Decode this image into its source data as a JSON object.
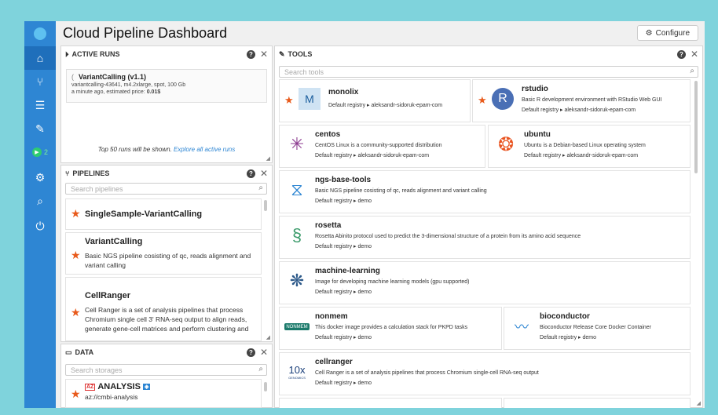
{
  "app": {
    "title": "Cloud Pipeline Dashboard",
    "configure_label": "Configure"
  },
  "nav": {
    "runs_count": "2"
  },
  "active_runs": {
    "header": "ACTIVE RUNS",
    "run": {
      "prefix": "(",
      "name": "VariantCalling (v1.1)",
      "meta": "variantcalling-43641, m4.2xlarge, spot, 100 Gb",
      "time_text": "a minute ago, estimated price: ",
      "price": "0.01$"
    },
    "footer_text": "Top 50 runs will be shown. ",
    "footer_link": "Explore all active runs"
  },
  "pipelines": {
    "header": "PIPELINES",
    "search_placeholder": "Search pipelines",
    "items": [
      {
        "name": "SingleSample-VariantCalling",
        "desc": ""
      },
      {
        "name": "VariantCalling",
        "desc": "Basic NGS pipeline cosisting of qc, reads alignment and variant calling"
      },
      {
        "name": "CellRanger",
        "desc": "Cell Ranger is a set of analysis pipelines that process Chromium single cell 3' RNA-seq output to align reads, generate gene-cell matrices and perform clustering and"
      }
    ]
  },
  "data": {
    "header": "DATA",
    "search_placeholder": "Search storages",
    "items": [
      {
        "badge": "AZ",
        "name": "ANALYSIS",
        "path": "az://cmbi-analysis"
      }
    ]
  },
  "tools": {
    "header": "TOOLS",
    "search_placeholder": "Search tools",
    "items": [
      {
        "name": "monolix",
        "desc": "",
        "registry": "Default registry ▸ aleksandr-sidoruk-epam-com"
      },
      {
        "name": "rstudio",
        "desc": "Basic R development environment with RStudio Web GUI",
        "registry": "Default registry ▸ aleksandr-sidoruk-epam-com"
      },
      {
        "name": "centos",
        "desc": "CentOS Linux is a community-supported distribution",
        "registry": "Default registry ▸ aleksandr-sidoruk-epam-com"
      },
      {
        "name": "ubuntu",
        "desc": "Ubuntu is a Debian-based Linux operating system",
        "registry": "Default registry ▸ aleksandr-sidoruk-epam-com"
      },
      {
        "name": "ngs-base-tools",
        "desc": "Basic NGS pipeline cosisting of qc, reads alignment and variant calling",
        "registry": "Default registry ▸ demo"
      },
      {
        "name": "rosetta",
        "desc": "Rosetta Abinito protocol used to predict the 3-dimensional structure of a protein from its amino acid sequence",
        "registry": "Default registry ▸ demo"
      },
      {
        "name": "machine-learning",
        "desc": "Image for developing machine learning models (gpu supported)",
        "registry": "Default registry ▸ demo"
      },
      {
        "name": "nonmem",
        "desc": "This docker image provides a calculation stack for PKPD tasks",
        "registry": "Default registry ▸ demo"
      },
      {
        "name": "bioconductor",
        "desc": "Bioconductor Release Core Docker Container",
        "registry": "Default registry ▸ demo"
      },
      {
        "name": "cellranger",
        "desc": "Cell Ranger is a set of analysis pipelines that process Chromium single-cell RNA-seq output",
        "registry": "Default registry ▸ demo"
      }
    ],
    "logos": {
      "rstudio": "R",
      "nonmem": "NONMEM",
      "cellranger": "10x",
      "cellranger_sub": "GENOMICS"
    }
  },
  "colors": {
    "sidebar": "#2e86d3",
    "accent": "#e85a1b",
    "link": "#2e86d3",
    "background": "#7fd3dc"
  }
}
